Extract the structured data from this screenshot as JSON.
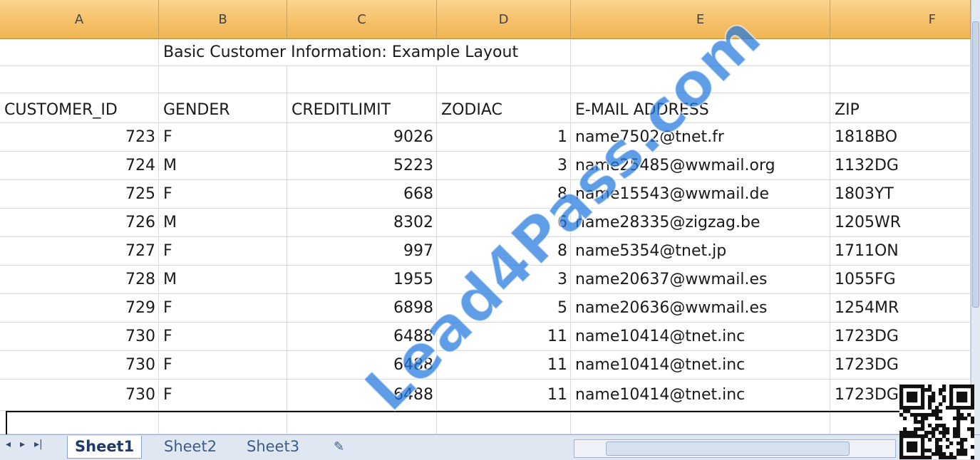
{
  "columns": [
    "A",
    "B",
    "C",
    "D",
    "E",
    "F"
  ],
  "title_cell": "Basic Customer Information: Example Layout",
  "headers": [
    "CUSTOMER_ID",
    "GENDER",
    "CREDITLIMIT",
    "ZODIAC",
    "E-MAIL ADDRESS",
    "ZIP"
  ],
  "rows": [
    [
      "723",
      "F",
      "9026",
      "1",
      "name7502@tnet.fr",
      "1818BO"
    ],
    [
      "724",
      "M",
      "5223",
      "3",
      "name25485@wwmail.org",
      "1132DG"
    ],
    [
      "725",
      "F",
      "668",
      "8",
      "name15543@wwmail.de",
      "1803YT"
    ],
    [
      "726",
      "M",
      "8302",
      "6",
      "name28335@zigzag.be",
      "1205WR"
    ],
    [
      "727",
      "F",
      "997",
      "8",
      "name5354@tnet.jp",
      "1711ON"
    ],
    [
      "728",
      "M",
      "1955",
      "3",
      "name20637@wwmail.es",
      "1055FG"
    ],
    [
      "729",
      "F",
      "6898",
      "5",
      "name20636@wwmail.es",
      "1254MR"
    ],
    [
      "730",
      "F",
      "6488",
      "11",
      "name10414@tnet.inc",
      "1723DG"
    ],
    [
      "730",
      "F",
      "6488",
      "11",
      "name10414@tnet.inc",
      "1723DG"
    ],
    [
      "730",
      "F",
      "6488",
      "11",
      "name10414@tnet.inc",
      "1723DG"
    ]
  ],
  "tabs": [
    "Sheet1",
    "Sheet2",
    "Sheet3"
  ],
  "active_tab": "Sheet1",
  "nav_glyphs": [
    "◂",
    "▸",
    "▸|"
  ],
  "watermark": "Lead4Pass.com",
  "colors": {
    "header_fill": "#f5c16a",
    "grid": "#d9d9d9",
    "tabbar": "#dfe7f3",
    "watermark": "#2178dc"
  }
}
